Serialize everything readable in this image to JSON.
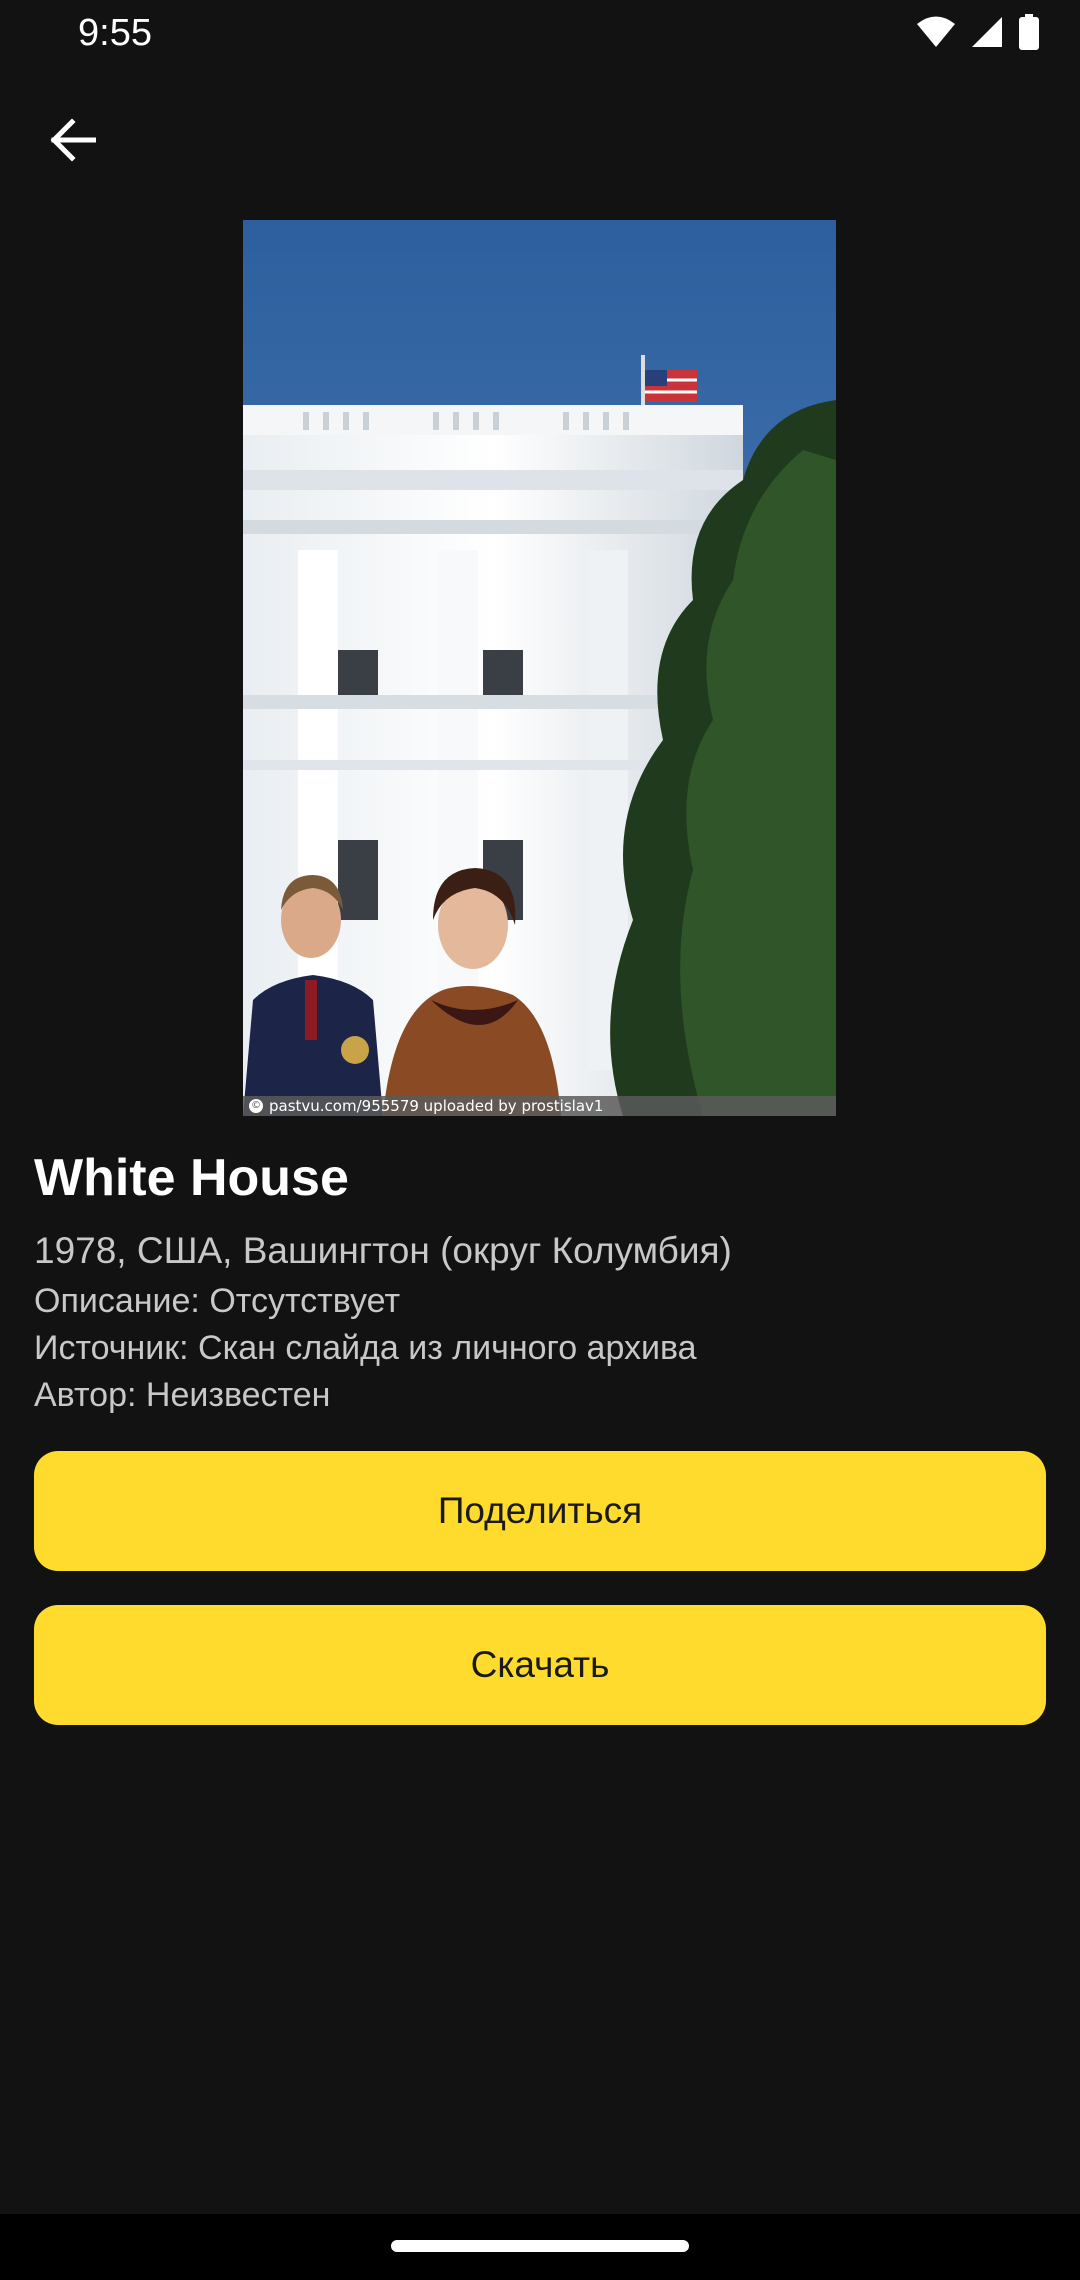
{
  "status_bar": {
    "time": "9:55",
    "icons": [
      "wifi-icon",
      "signal-icon",
      "battery-icon"
    ]
  },
  "toolbar": {
    "back_icon": "arrow-left-icon"
  },
  "photo": {
    "watermark": "pastvu.com/955579  uploaded by prostislav1"
  },
  "details": {
    "title": "White House",
    "place": "1978, США, Вашингтон (округ Колумбия)",
    "description": "Описание: Отсутствует",
    "source": "Источник: Скан слайда из личного архива",
    "author": "Автор: Неизвестен"
  },
  "actions": {
    "share_label": "Поделиться",
    "download_label": "Скачать"
  },
  "colors": {
    "background": "#121212",
    "accent": "#fedb2d",
    "button_text": "#1a1a1a",
    "secondary_text": "#c8c8c8"
  }
}
